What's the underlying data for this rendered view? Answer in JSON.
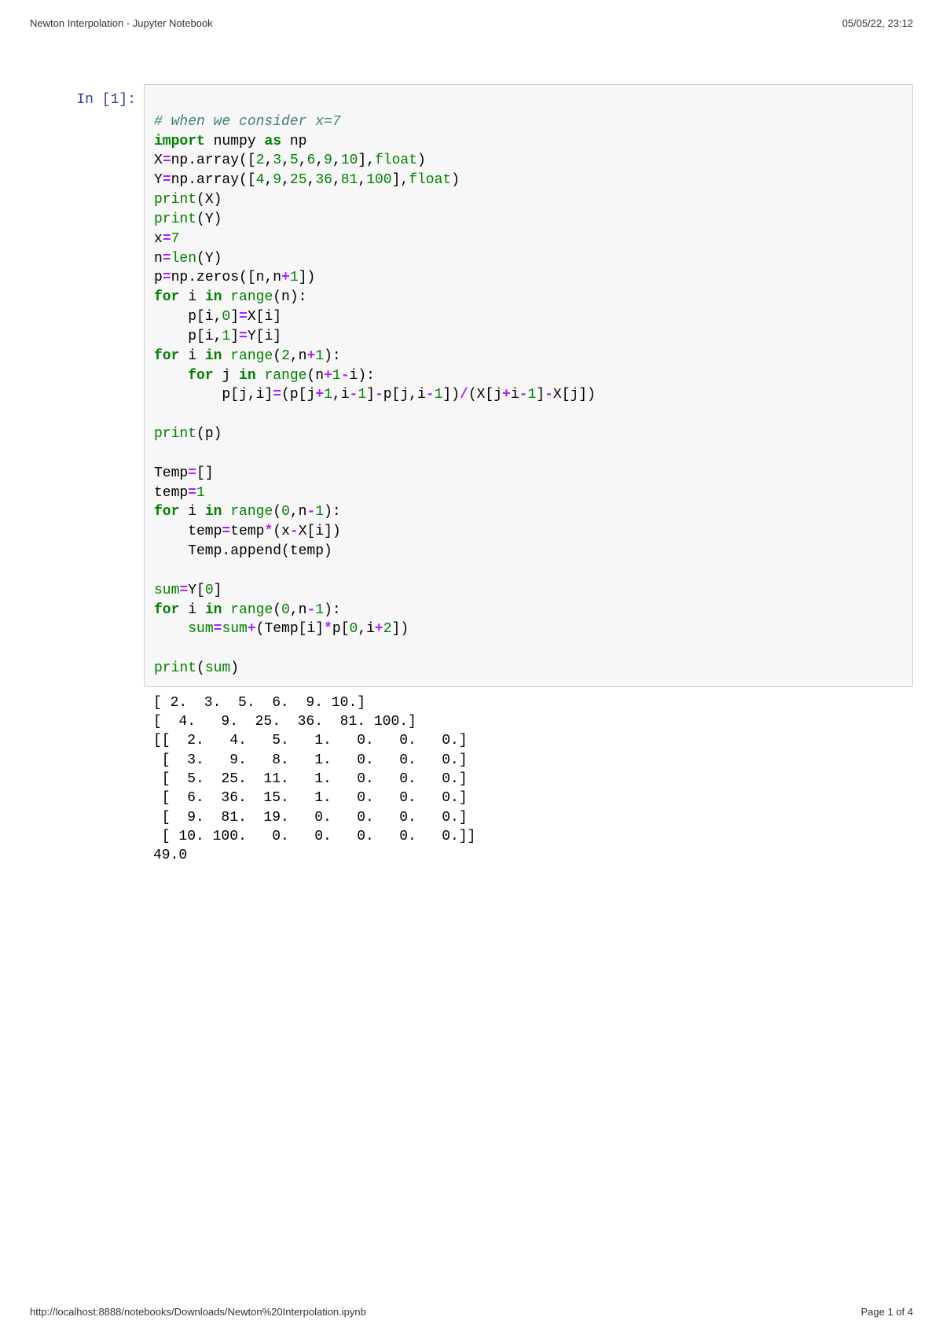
{
  "header": {
    "title": "Newton Interpolation - Jupyter Notebook",
    "timestamp": "05/05/22, 23:12"
  },
  "footer": {
    "url": "http://localhost:8888/notebooks/Downloads/Newton%20Interpolation.ipynb",
    "page": "Page 1 of 4"
  },
  "cell": {
    "prompt": "In [1]:",
    "code_tokens": [
      {
        "t": "\n",
        "c": ""
      },
      {
        "t": "# when we consider x=7",
        "c": "tok-comment"
      },
      {
        "t": "\n",
        "c": ""
      },
      {
        "t": "import",
        "c": "tok-keyword"
      },
      {
        "t": " numpy ",
        "c": "tok-name"
      },
      {
        "t": "as",
        "c": "tok-keyword"
      },
      {
        "t": " np",
        "c": "tok-name"
      },
      {
        "t": "\n",
        "c": ""
      },
      {
        "t": "X",
        "c": "tok-name"
      },
      {
        "t": "=",
        "c": "tok-operator"
      },
      {
        "t": "np.array([",
        "c": "tok-name"
      },
      {
        "t": "2",
        "c": "tok-number"
      },
      {
        "t": ",",
        "c": "tok-punct"
      },
      {
        "t": "3",
        "c": "tok-number"
      },
      {
        "t": ",",
        "c": "tok-punct"
      },
      {
        "t": "5",
        "c": "tok-number"
      },
      {
        "t": ",",
        "c": "tok-punct"
      },
      {
        "t": "6",
        "c": "tok-number"
      },
      {
        "t": ",",
        "c": "tok-punct"
      },
      {
        "t": "9",
        "c": "tok-number"
      },
      {
        "t": ",",
        "c": "tok-punct"
      },
      {
        "t": "10",
        "c": "tok-number"
      },
      {
        "t": "],",
        "c": "tok-punct"
      },
      {
        "t": "float",
        "c": "tok-builtin"
      },
      {
        "t": ")",
        "c": "tok-punct"
      },
      {
        "t": "\n",
        "c": ""
      },
      {
        "t": "Y",
        "c": "tok-name"
      },
      {
        "t": "=",
        "c": "tok-operator"
      },
      {
        "t": "np.array([",
        "c": "tok-name"
      },
      {
        "t": "4",
        "c": "tok-number"
      },
      {
        "t": ",",
        "c": "tok-punct"
      },
      {
        "t": "9",
        "c": "tok-number"
      },
      {
        "t": ",",
        "c": "tok-punct"
      },
      {
        "t": "25",
        "c": "tok-number"
      },
      {
        "t": ",",
        "c": "tok-punct"
      },
      {
        "t": "36",
        "c": "tok-number"
      },
      {
        "t": ",",
        "c": "tok-punct"
      },
      {
        "t": "81",
        "c": "tok-number"
      },
      {
        "t": ",",
        "c": "tok-punct"
      },
      {
        "t": "100",
        "c": "tok-number"
      },
      {
        "t": "],",
        "c": "tok-punct"
      },
      {
        "t": "float",
        "c": "tok-builtin"
      },
      {
        "t": ")",
        "c": "tok-punct"
      },
      {
        "t": "\n",
        "c": ""
      },
      {
        "t": "print",
        "c": "tok-print"
      },
      {
        "t": "(X)",
        "c": "tok-punct"
      },
      {
        "t": "\n",
        "c": ""
      },
      {
        "t": "print",
        "c": "tok-print"
      },
      {
        "t": "(Y)",
        "c": "tok-punct"
      },
      {
        "t": "\n",
        "c": ""
      },
      {
        "t": "x",
        "c": "tok-name"
      },
      {
        "t": "=",
        "c": "tok-operator"
      },
      {
        "t": "7",
        "c": "tok-number"
      },
      {
        "t": "\n",
        "c": ""
      },
      {
        "t": "n",
        "c": "tok-name"
      },
      {
        "t": "=",
        "c": "tok-operator"
      },
      {
        "t": "len",
        "c": "tok-builtin"
      },
      {
        "t": "(Y)",
        "c": "tok-punct"
      },
      {
        "t": "\n",
        "c": ""
      },
      {
        "t": "p",
        "c": "tok-name"
      },
      {
        "t": "=",
        "c": "tok-operator"
      },
      {
        "t": "np.zeros([n,n",
        "c": "tok-name"
      },
      {
        "t": "+",
        "c": "tok-operator"
      },
      {
        "t": "1",
        "c": "tok-number"
      },
      {
        "t": "])",
        "c": "tok-punct"
      },
      {
        "t": "\n",
        "c": ""
      },
      {
        "t": "for",
        "c": "tok-keyword"
      },
      {
        "t": " i ",
        "c": "tok-name"
      },
      {
        "t": "in",
        "c": "tok-keyword"
      },
      {
        "t": " ",
        "c": ""
      },
      {
        "t": "range",
        "c": "tok-builtin"
      },
      {
        "t": "(n):",
        "c": "tok-punct"
      },
      {
        "t": "\n",
        "c": ""
      },
      {
        "t": "    p[i,",
        "c": "tok-name"
      },
      {
        "t": "0",
        "c": "tok-number"
      },
      {
        "t": "]",
        "c": "tok-punct"
      },
      {
        "t": "=",
        "c": "tok-operator"
      },
      {
        "t": "X[i]",
        "c": "tok-name"
      },
      {
        "t": "\n",
        "c": ""
      },
      {
        "t": "    p[i,",
        "c": "tok-name"
      },
      {
        "t": "1",
        "c": "tok-number"
      },
      {
        "t": "]",
        "c": "tok-punct"
      },
      {
        "t": "=",
        "c": "tok-operator"
      },
      {
        "t": "Y[i]",
        "c": "tok-name"
      },
      {
        "t": "\n",
        "c": ""
      },
      {
        "t": "for",
        "c": "tok-keyword"
      },
      {
        "t": " i ",
        "c": "tok-name"
      },
      {
        "t": "in",
        "c": "tok-keyword"
      },
      {
        "t": " ",
        "c": ""
      },
      {
        "t": "range",
        "c": "tok-builtin"
      },
      {
        "t": "(",
        "c": "tok-punct"
      },
      {
        "t": "2",
        "c": "tok-number"
      },
      {
        "t": ",n",
        "c": "tok-name"
      },
      {
        "t": "+",
        "c": "tok-operator"
      },
      {
        "t": "1",
        "c": "tok-number"
      },
      {
        "t": "):",
        "c": "tok-punct"
      },
      {
        "t": "\n",
        "c": ""
      },
      {
        "t": "    ",
        "c": ""
      },
      {
        "t": "for",
        "c": "tok-keyword"
      },
      {
        "t": " j ",
        "c": "tok-name"
      },
      {
        "t": "in",
        "c": "tok-keyword"
      },
      {
        "t": " ",
        "c": ""
      },
      {
        "t": "range",
        "c": "tok-builtin"
      },
      {
        "t": "(n",
        "c": "tok-name"
      },
      {
        "t": "+",
        "c": "tok-operator"
      },
      {
        "t": "1",
        "c": "tok-number"
      },
      {
        "t": "-",
        "c": "tok-operator"
      },
      {
        "t": "i):",
        "c": "tok-name"
      },
      {
        "t": "\n",
        "c": ""
      },
      {
        "t": "        p[j,i]",
        "c": "tok-name"
      },
      {
        "t": "=",
        "c": "tok-operator"
      },
      {
        "t": "(p[j",
        "c": "tok-name"
      },
      {
        "t": "+",
        "c": "tok-operator"
      },
      {
        "t": "1",
        "c": "tok-number"
      },
      {
        "t": ",i",
        "c": "tok-name"
      },
      {
        "t": "-",
        "c": "tok-operator"
      },
      {
        "t": "1",
        "c": "tok-number"
      },
      {
        "t": "]",
        "c": "tok-punct"
      },
      {
        "t": "-",
        "c": "tok-operator"
      },
      {
        "t": "p[j,i",
        "c": "tok-name"
      },
      {
        "t": "-",
        "c": "tok-operator"
      },
      {
        "t": "1",
        "c": "tok-number"
      },
      {
        "t": "])",
        "c": "tok-punct"
      },
      {
        "t": "/",
        "c": "tok-operator"
      },
      {
        "t": "(X[j",
        "c": "tok-name"
      },
      {
        "t": "+",
        "c": "tok-operator"
      },
      {
        "t": "i",
        "c": "tok-name"
      },
      {
        "t": "-",
        "c": "tok-operator"
      },
      {
        "t": "1",
        "c": "tok-number"
      },
      {
        "t": "]",
        "c": "tok-punct"
      },
      {
        "t": "-",
        "c": "tok-operator"
      },
      {
        "t": "X[j])",
        "c": "tok-name"
      },
      {
        "t": "\n",
        "c": ""
      },
      {
        "t": "        ",
        "c": ""
      },
      {
        "t": "\n",
        "c": ""
      },
      {
        "t": "print",
        "c": "tok-print"
      },
      {
        "t": "(p)",
        "c": "tok-punct"
      },
      {
        "t": "\n",
        "c": ""
      },
      {
        "t": "\n",
        "c": ""
      },
      {
        "t": "Temp",
        "c": "tok-name"
      },
      {
        "t": "=",
        "c": "tok-operator"
      },
      {
        "t": "[]",
        "c": "tok-punct"
      },
      {
        "t": "\n",
        "c": ""
      },
      {
        "t": "temp",
        "c": "tok-name"
      },
      {
        "t": "=",
        "c": "tok-operator"
      },
      {
        "t": "1",
        "c": "tok-number"
      },
      {
        "t": "\n",
        "c": ""
      },
      {
        "t": "for",
        "c": "tok-keyword"
      },
      {
        "t": " i ",
        "c": "tok-name"
      },
      {
        "t": "in",
        "c": "tok-keyword"
      },
      {
        "t": " ",
        "c": ""
      },
      {
        "t": "range",
        "c": "tok-builtin"
      },
      {
        "t": "(",
        "c": "tok-punct"
      },
      {
        "t": "0",
        "c": "tok-number"
      },
      {
        "t": ",n",
        "c": "tok-name"
      },
      {
        "t": "-",
        "c": "tok-operator"
      },
      {
        "t": "1",
        "c": "tok-number"
      },
      {
        "t": "):",
        "c": "tok-punct"
      },
      {
        "t": "\n",
        "c": ""
      },
      {
        "t": "    temp",
        "c": "tok-name"
      },
      {
        "t": "=",
        "c": "tok-operator"
      },
      {
        "t": "temp",
        "c": "tok-name"
      },
      {
        "t": "*",
        "c": "tok-operator"
      },
      {
        "t": "(x",
        "c": "tok-name"
      },
      {
        "t": "-",
        "c": "tok-operator"
      },
      {
        "t": "X[i])",
        "c": "tok-name"
      },
      {
        "t": "\n",
        "c": ""
      },
      {
        "t": "    Temp.append(temp)",
        "c": "tok-name"
      },
      {
        "t": "\n",
        "c": ""
      },
      {
        "t": "\n",
        "c": ""
      },
      {
        "t": "sum",
        "c": "tok-builtin"
      },
      {
        "t": "=",
        "c": "tok-operator"
      },
      {
        "t": "Y[",
        "c": "tok-name"
      },
      {
        "t": "0",
        "c": "tok-number"
      },
      {
        "t": "]",
        "c": "tok-punct"
      },
      {
        "t": "\n",
        "c": ""
      },
      {
        "t": "for",
        "c": "tok-keyword"
      },
      {
        "t": " i ",
        "c": "tok-name"
      },
      {
        "t": "in",
        "c": "tok-keyword"
      },
      {
        "t": " ",
        "c": ""
      },
      {
        "t": "range",
        "c": "tok-builtin"
      },
      {
        "t": "(",
        "c": "tok-punct"
      },
      {
        "t": "0",
        "c": "tok-number"
      },
      {
        "t": ",n",
        "c": "tok-name"
      },
      {
        "t": "-",
        "c": "tok-operator"
      },
      {
        "t": "1",
        "c": "tok-number"
      },
      {
        "t": "):",
        "c": "tok-punct"
      },
      {
        "t": "\n",
        "c": ""
      },
      {
        "t": "    ",
        "c": ""
      },
      {
        "t": "sum",
        "c": "tok-builtin"
      },
      {
        "t": "=",
        "c": "tok-operator"
      },
      {
        "t": "sum",
        "c": "tok-builtin"
      },
      {
        "t": "+",
        "c": "tok-operator"
      },
      {
        "t": "(Temp[i]",
        "c": "tok-name"
      },
      {
        "t": "*",
        "c": "tok-operator"
      },
      {
        "t": "p[",
        "c": "tok-name"
      },
      {
        "t": "0",
        "c": "tok-number"
      },
      {
        "t": ",i",
        "c": "tok-name"
      },
      {
        "t": "+",
        "c": "tok-operator"
      },
      {
        "t": "2",
        "c": "tok-number"
      },
      {
        "t": "])",
        "c": "tok-punct"
      },
      {
        "t": "\n",
        "c": ""
      },
      {
        "t": "\n",
        "c": ""
      },
      {
        "t": "print",
        "c": "tok-print"
      },
      {
        "t": "(",
        "c": "tok-punct"
      },
      {
        "t": "sum",
        "c": "tok-builtin"
      },
      {
        "t": ")",
        "c": "tok-punct"
      }
    ],
    "output": "[ 2.  3.  5.  6.  9. 10.]\n[  4.   9.  25.  36.  81. 100.]\n[[  2.   4.   5.   1.   0.   0.   0.]\n [  3.   9.   8.   1.   0.   0.   0.]\n [  5.  25.  11.   1.   0.   0.   0.]\n [  6.  36.  15.   1.   0.   0.   0.]\n [  9.  81.  19.   0.   0.   0.   0.]\n [ 10. 100.   0.   0.   0.   0.   0.]]\n49.0"
  }
}
